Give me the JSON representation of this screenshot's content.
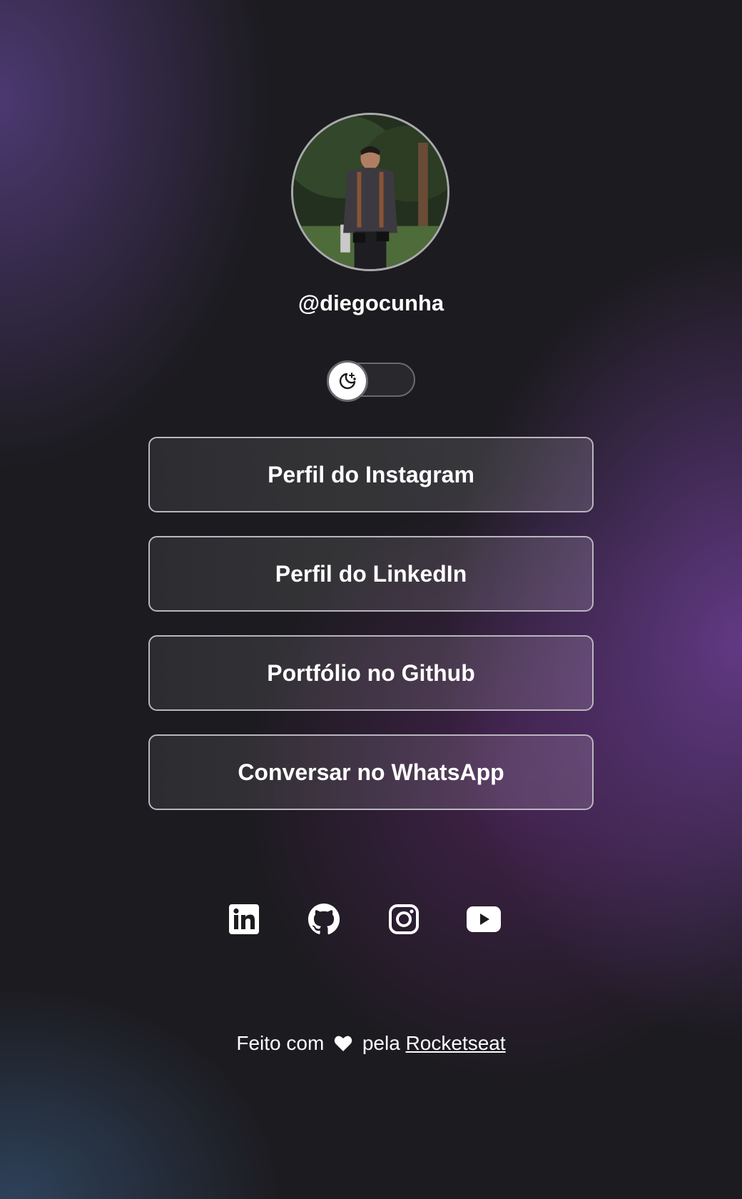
{
  "profile": {
    "handle": "@diegocunha"
  },
  "theme_toggle": {
    "icon": "moon-stars-icon",
    "state": "off"
  },
  "links": [
    {
      "label": "Perfil do Instagram"
    },
    {
      "label": "Perfil do LinkedIn"
    },
    {
      "label": "Portfólio no Github"
    },
    {
      "label": "Conversar no WhatsApp"
    }
  ],
  "socials": [
    {
      "icon": "linkedin-icon"
    },
    {
      "icon": "github-icon"
    },
    {
      "icon": "instagram-icon"
    },
    {
      "icon": "youtube-icon"
    }
  ],
  "footer": {
    "prefix": "Feito com",
    "middle": "pela",
    "brand": "Rocketseat"
  },
  "colors": {
    "background": "#1c1b1f",
    "text": "#ffffff",
    "border": "#b9b6bf",
    "accent_purple": "#6e3e96"
  }
}
